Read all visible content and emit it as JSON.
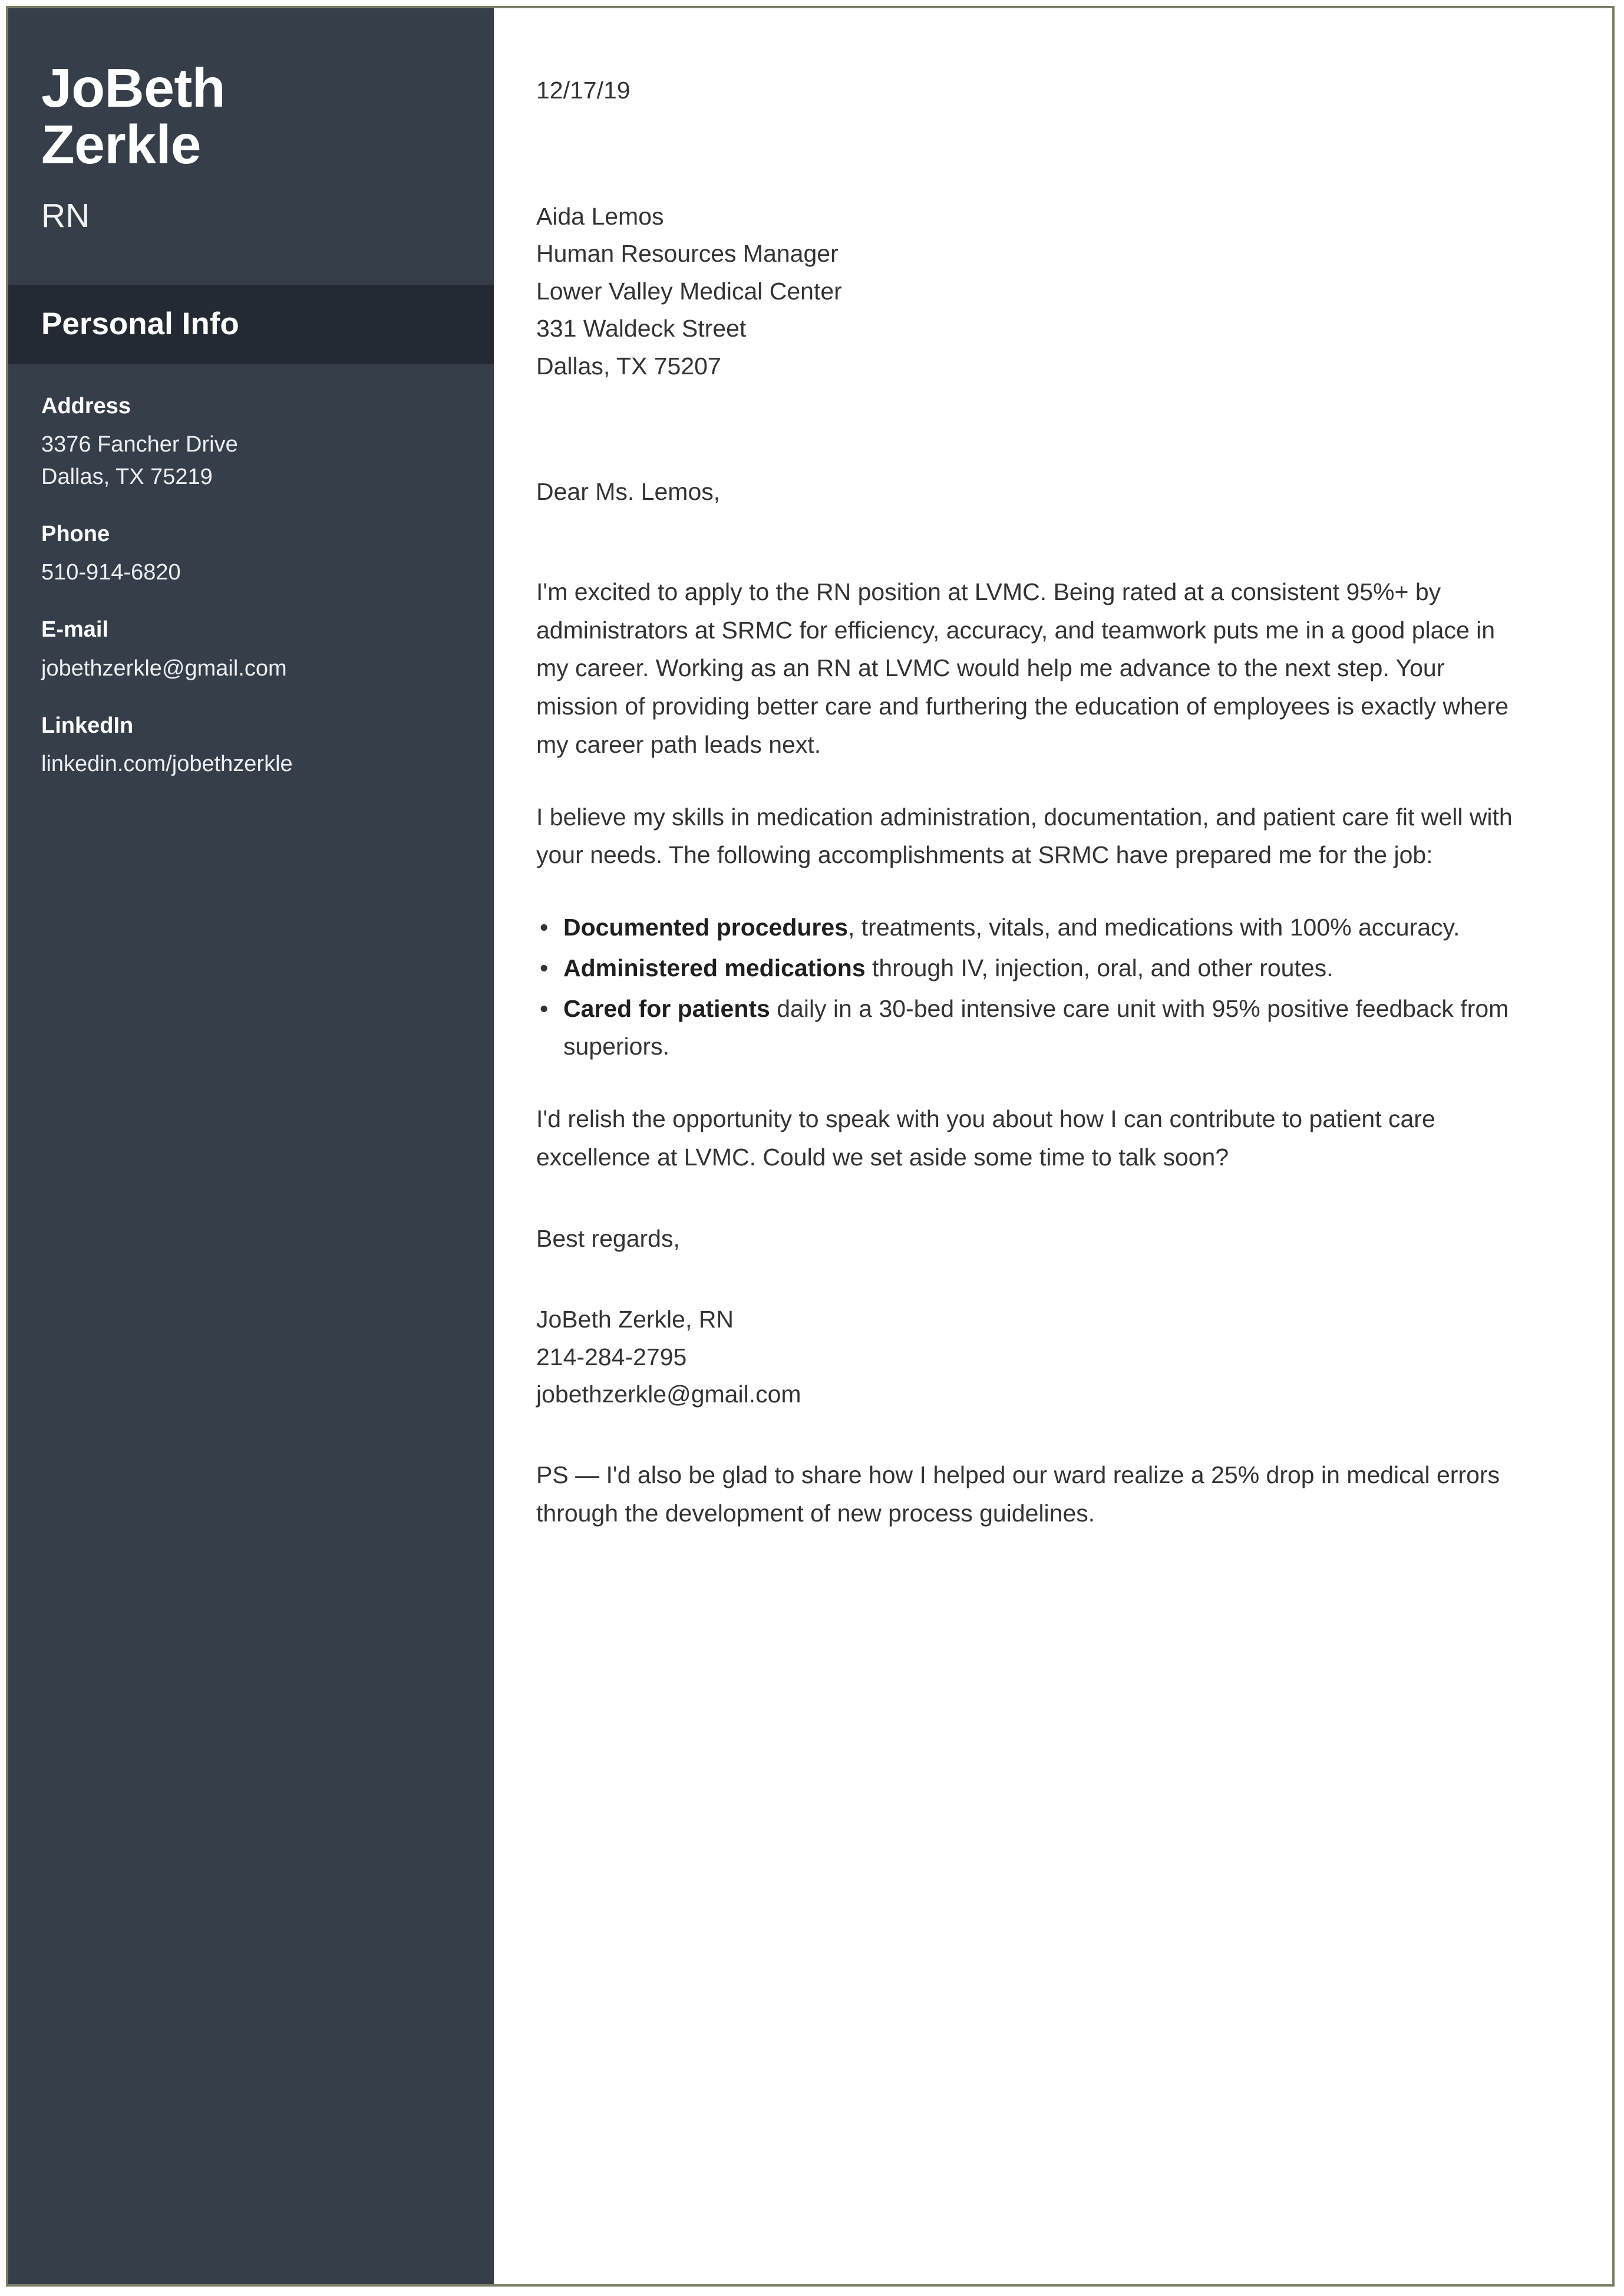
{
  "sidebar": {
    "name_first": "JoBeth",
    "name_last": "Zerkle",
    "job_title": "RN",
    "section_title": "Personal Info",
    "contacts": [
      {
        "label": "Address",
        "line1": "3376 Fancher Drive",
        "line2": "Dallas, TX 75219"
      },
      {
        "label": "Phone",
        "line1": "510-914-6820"
      },
      {
        "label": "E-mail",
        "line1": "jobethzerkle@gmail.com"
      },
      {
        "label": "LinkedIn",
        "line1": "linkedin.com/jobethzerkle"
      }
    ]
  },
  "letter": {
    "date": "12/17/19",
    "recipient": {
      "name": "Aida Lemos",
      "position": "Human Resources Manager",
      "company": "Lower Valley Medical Center",
      "street": "331 Waldeck Street",
      "city_state_zip": "Dallas, TX 75207"
    },
    "salutation": "Dear Ms. Lemos,",
    "paragraph_1": "I'm excited to apply to the RN position at LVMC. Being rated at a consistent 95%+ by administrators at SRMC for efficiency, accuracy, and teamwork puts me in a good place in my career. Working as an RN at LVMC would help me advance to the next step. Your mission of providing better care and furthering the education of employees is exactly where my career path leads next.",
    "paragraph_2": "I believe my skills in medication administration, documentation, and patient care fit well with your needs. The following accomplishments at SRMC have prepared me for the job:",
    "bullets": [
      {
        "bold": "Documented procedures",
        "rest": ", treatments, vitals, and medications with 100% accuracy."
      },
      {
        "bold": "Administered medications",
        "rest": " through IV, injection, oral, and other routes."
      },
      {
        "bold": "Cared for patients",
        "rest": " daily in a 30-bed intensive care unit with 95% positive feedback from superiors."
      }
    ],
    "paragraph_3": "I'd relish the opportunity to speak with you about how I can contribute to patient care excellence at LVMC. Could we set aside some time to talk soon?",
    "closing": "Best regards,",
    "signature": {
      "name": "JoBeth Zerkle, RN",
      "phone": "214-284-2795",
      "email": "jobethzerkle@gmail.com"
    },
    "postscript": "PS — I'd also be glad to share how I helped our ward realize a 25% drop in medical errors through the development of new process guidelines."
  },
  "colors": {
    "sidebar_bg": "#363e4a",
    "section_band_bg": "#242a33",
    "page_border": "#7d7d66",
    "body_text": "#333333",
    "sidebar_text": "#ffffff"
  }
}
